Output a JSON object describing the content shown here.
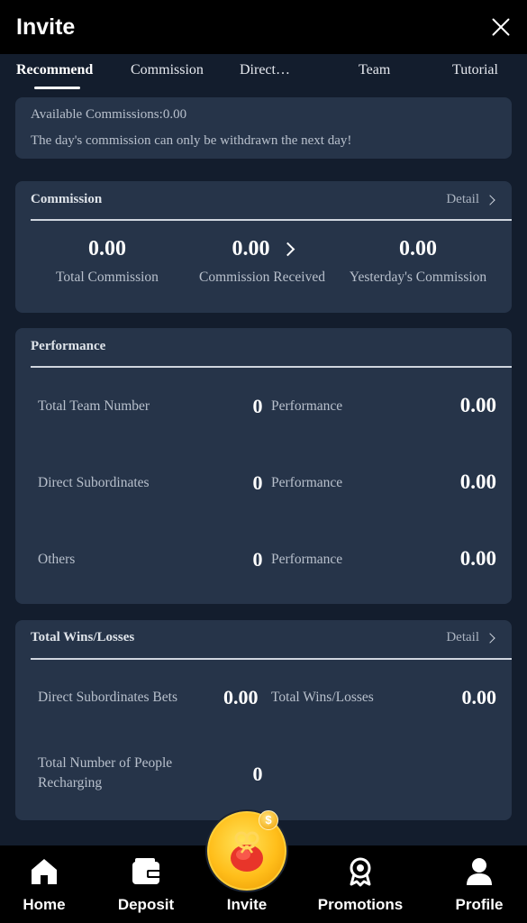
{
  "header": {
    "title": "Invite",
    "close_icon": "close-icon"
  },
  "tabs": [
    {
      "label": "Recommend",
      "active": true
    },
    {
      "label": "Commission",
      "active": false
    },
    {
      "label": "Direct…",
      "active": false
    },
    {
      "label": "Team",
      "active": false
    },
    {
      "label": "Tutorial",
      "active": false
    }
  ],
  "notice": {
    "available_label": "Available Commissions:",
    "available_value": "0.00",
    "note": "The day's commission can only be withdrawn the next day!"
  },
  "commission": {
    "title": "Commission",
    "detail": "Detail",
    "stats": [
      {
        "value": "0.00",
        "label": "Total Commission"
      },
      {
        "value": "0.00",
        "label": "Commission Received"
      },
      {
        "value": "0.00",
        "label": "Yesterday's Commission"
      }
    ]
  },
  "performance": {
    "title": "Performance",
    "rows": [
      {
        "name": "Total Team Number",
        "count": "0",
        "perf_label": "Performance",
        "perf_value": "0.00"
      },
      {
        "name": "Direct Subordinates",
        "count": "0",
        "perf_label": "Performance",
        "perf_value": "0.00"
      },
      {
        "name": "Others",
        "count": "0",
        "perf_label": "Performance",
        "perf_value": "0.00"
      }
    ]
  },
  "wins": {
    "title": "Total Wins/Losses",
    "detail": "Detail",
    "direct_bets_label": "Direct Subordinates Bets",
    "direct_bets_value": "0.00",
    "total_wl_label": "Total Wins/Losses",
    "total_wl_value": "0.00",
    "recharging_label_1": "Total Number of People",
    "recharging_label_2": "Recharging",
    "recharging_value": "0"
  },
  "bottom_nav": [
    {
      "label": "Home",
      "icon": "home-icon"
    },
    {
      "label": "Deposit",
      "icon": "wallet-icon"
    },
    {
      "label": "Invite",
      "icon": "gift-bag-icon"
    },
    {
      "label": "Promotions",
      "icon": "award-badge-icon"
    },
    {
      "label": "Profile",
      "icon": "user-icon"
    }
  ],
  "colors": {
    "page_bg": "#131d2d",
    "card_bg": "#263449",
    "nav_bg": "#000000",
    "invite_gold": "#ffbe1a"
  }
}
